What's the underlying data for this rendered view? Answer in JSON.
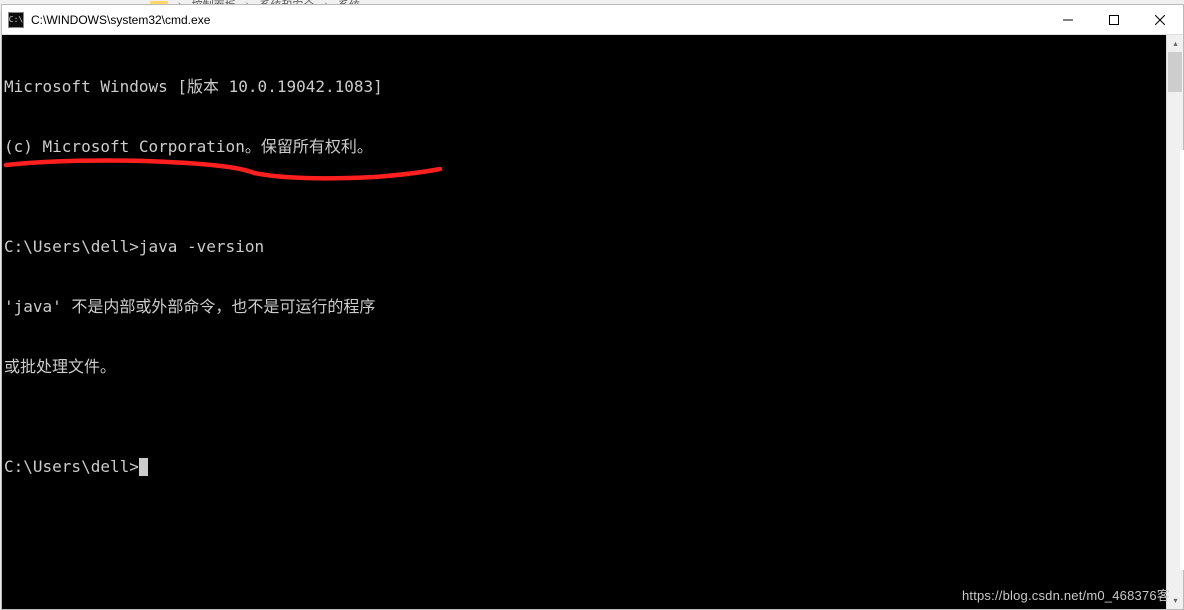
{
  "background_breadcrumb": {
    "item1": "控制面板",
    "item2": "系统和安全",
    "item3": "系统"
  },
  "titlebar": {
    "icon_label": "C:\\",
    "title": "C:\\WINDOWS\\system32\\cmd.exe"
  },
  "window_controls": {
    "minimize": "minimize",
    "maximize": "maximize",
    "close": "close"
  },
  "terminal": {
    "lines": [
      "Microsoft Windows [版本 10.0.19042.1083]",
      "(c) Microsoft Corporation。保留所有权利。",
      "",
      "C:\\Users\\dell>java -version",
      "'java' 不是内部或外部命令，也不是可运行的程序",
      "或批处理文件。",
      "",
      "C:\\Users\\dell>"
    ]
  },
  "annotation": {
    "color": "#ff1f1f",
    "description": "hand-drawn red underline beneath the error message"
  },
  "watermark": "https://blog.csdn.net/m0_468376客"
}
